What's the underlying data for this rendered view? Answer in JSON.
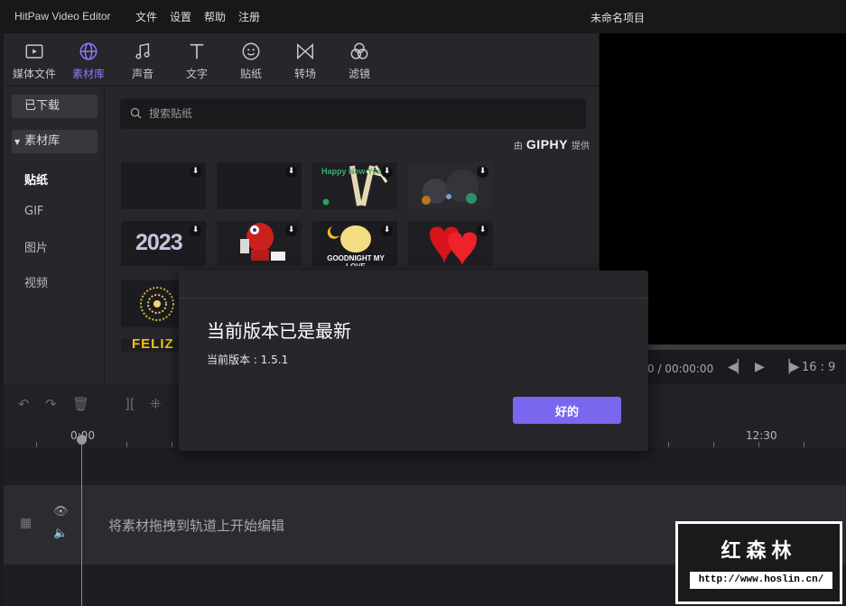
{
  "titlebar": {
    "app_name": "HitPaw Video Editor",
    "menu": [
      "文件",
      "设置",
      "帮助",
      "注册"
    ],
    "project_name": "未命名项目"
  },
  "toolbar": {
    "tools": [
      {
        "label": "媒体文件",
        "icon": "media-icon"
      },
      {
        "label": "素材库",
        "icon": "globe-icon",
        "active": true
      },
      {
        "label": "声音",
        "icon": "music-note-icon"
      },
      {
        "label": "文字",
        "icon": "text-icon"
      },
      {
        "label": "贴纸",
        "icon": "sticker-icon"
      },
      {
        "label": "转场",
        "icon": "transition-icon"
      },
      {
        "label": "滤镜",
        "icon": "filter-icon"
      }
    ],
    "accent_color": "#8d7bff"
  },
  "sidebar": {
    "downloaded": "已下载",
    "library_group": "素材库",
    "items": [
      "贴纸",
      "GIF",
      "图片",
      "视频"
    ],
    "active_item": "贴纸"
  },
  "content": {
    "search_placeholder": "搜索贴纸",
    "provider_prefix": "由",
    "provider_name": "GIPHY",
    "provider_suffix": "提供",
    "stickers": [
      {
        "name": "blank-sticker"
      },
      {
        "name": "blank-sticker"
      },
      {
        "name": "happy-new-year-sticker",
        "text": "Happy New Year!"
      },
      {
        "name": "fireworks-sticker"
      },
      {
        "name": "2023-sticker",
        "text": "2023"
      },
      {
        "name": "red-character-sticker"
      },
      {
        "name": "goodnight-chick-sticker",
        "text": "GOODNIGHT MY LOVE"
      },
      {
        "name": "hearts-sticker"
      },
      {
        "name": "gold-firework-sticker"
      },
      {
        "name": "feliz-sticker",
        "text": "FELIZ"
      }
    ]
  },
  "preview": {
    "time": "0 / 00:00:00",
    "ratio": "16 : 9"
  },
  "timeline": {
    "time_labels": [
      "0:00",
      "12:30"
    ],
    "drop_hint": "将素材拖拽到轨道上开始编辑"
  },
  "dialog": {
    "title": "当前版本已是最新",
    "version_text": "当前版本 : 1.5.1",
    "ok_label": "好的",
    "button_color": "#7a67f0"
  },
  "watermark": {
    "title": "红森林",
    "url": "http://www.hoslin.cn/"
  }
}
